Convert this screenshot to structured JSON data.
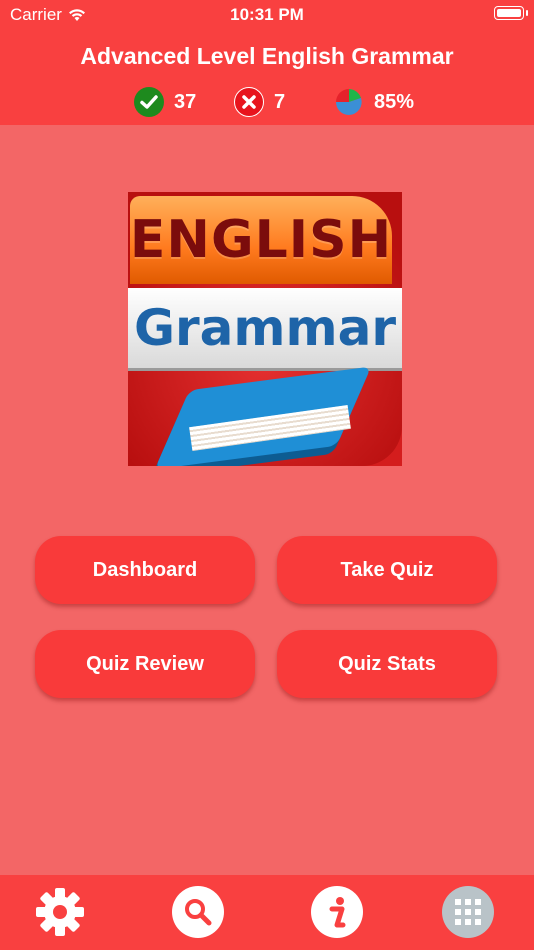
{
  "status_bar": {
    "carrier": "Carrier",
    "time": "10:31 PM"
  },
  "header": {
    "title": "Advanced Level English Grammar"
  },
  "stats": {
    "correct": "37",
    "wrong": "7",
    "percent": "85%"
  },
  "logo": {
    "line1": "ENGLISH",
    "line2": "Grammar"
  },
  "buttons": {
    "dashboard": "Dashboard",
    "take_quiz": "Take Quiz",
    "quiz_review": "Quiz Review",
    "quiz_stats": "Quiz Stats"
  },
  "tabbar": {
    "icons": [
      "gear-icon",
      "search-icon",
      "info-icon",
      "grid-icon"
    ]
  },
  "colors": {
    "background": "#f36666",
    "bar": "#f94040",
    "button": "#f93a3a",
    "correct": "#1e8a1e",
    "wrong": "#e8141d"
  }
}
